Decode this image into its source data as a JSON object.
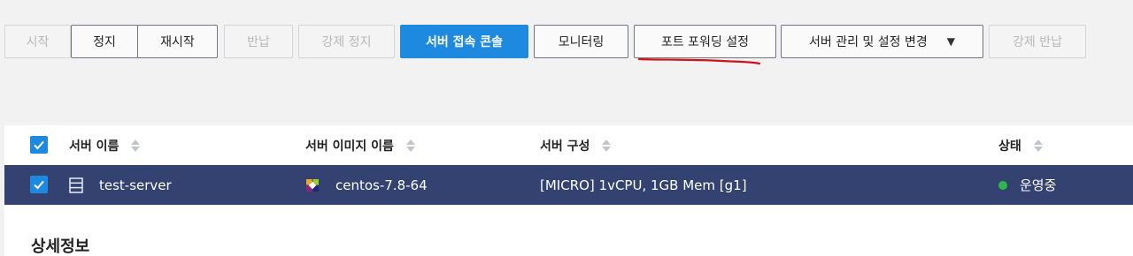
{
  "toolbar": {
    "buttons": [
      {
        "label": "시작",
        "state": "disabled"
      },
      {
        "label": "정지",
        "state": "enabled"
      },
      {
        "label": "재시작",
        "state": "enabled"
      },
      {
        "label": "반납",
        "state": "disabled"
      },
      {
        "label": "강제 정지",
        "state": "disabled"
      },
      {
        "label": "서버 접속 콘솔",
        "state": "primary"
      },
      {
        "label": "모니터링",
        "state": "enabled"
      },
      {
        "label": "포트 포워딩 설정",
        "state": "enabled",
        "highlighted": true
      },
      {
        "label": "서버 관리 및 설정 변경",
        "state": "enabled",
        "dropdown": true
      },
      {
        "label": "강제 반납",
        "state": "disabled"
      }
    ],
    "annotation_color": "#d0121b"
  },
  "table": {
    "columns": [
      {
        "label": "서버 이름"
      },
      {
        "label": "서버 이미지 이름"
      },
      {
        "label": "서버 구성"
      },
      {
        "label": "상태"
      }
    ],
    "header_checked": true,
    "rows": [
      {
        "checked": true,
        "server_name": "test-server",
        "image_name": "centos-7.8-64",
        "spec": "[MICRO] 1vCPU, 1GB Mem [g1]",
        "status": "운영중",
        "status_color": "#2db84b"
      }
    ],
    "selected_row_color": "#334270"
  },
  "detail": {
    "title": "상세정보"
  },
  "colors": {
    "primary": "#1d8ae0",
    "background": "#f2f2f2"
  }
}
